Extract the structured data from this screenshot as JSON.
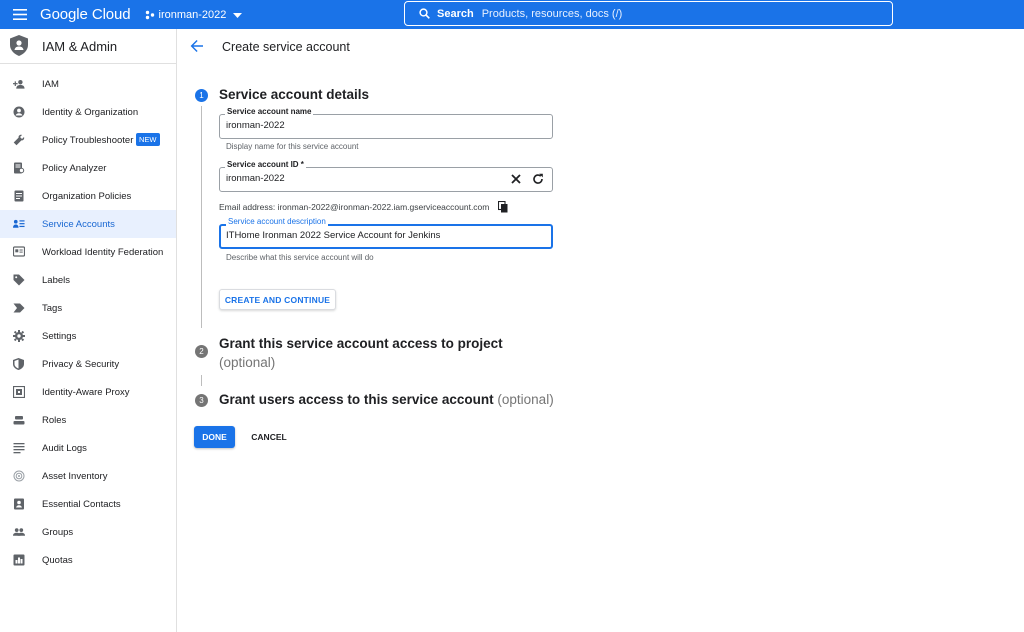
{
  "topbar": {
    "brand": "Google Cloud",
    "project": "ironman-2022",
    "search_label": "Search",
    "search_placeholder": "Products, resources, docs (/)",
    "accent": "#1a73e8"
  },
  "sidebar": {
    "title": "IAM & Admin",
    "items": [
      {
        "label": "IAM",
        "icon": "person-add-icon"
      },
      {
        "label": "Identity & Organization",
        "icon": "account-circle-icon"
      },
      {
        "label": "Policy Troubleshooter",
        "icon": "wrench-icon",
        "badge": "NEW"
      },
      {
        "label": "Policy Analyzer",
        "icon": "document-search-icon"
      },
      {
        "label": "Organization Policies",
        "icon": "document-icon"
      },
      {
        "label": "Service Accounts",
        "icon": "service-account-icon",
        "active": true
      },
      {
        "label": "Workload Identity Federation",
        "icon": "id-card-icon"
      },
      {
        "label": "Labels",
        "icon": "label-icon"
      },
      {
        "label": "Tags",
        "icon": "tag-arrow-icon"
      },
      {
        "label": "Settings",
        "icon": "gear-icon"
      },
      {
        "label": "Privacy & Security",
        "icon": "shield-icon"
      },
      {
        "label": "Identity-Aware Proxy",
        "icon": "proxy-icon"
      },
      {
        "label": "Roles",
        "icon": "roles-icon"
      },
      {
        "label": "Audit Logs",
        "icon": "list-icon"
      },
      {
        "label": "Asset Inventory",
        "icon": "inventory-icon"
      },
      {
        "label": "Essential Contacts",
        "icon": "contacts-icon"
      },
      {
        "label": "Groups",
        "icon": "groups-icon"
      },
      {
        "label": "Quotas",
        "icon": "quota-icon"
      }
    ]
  },
  "page": {
    "title": "Create service account"
  },
  "steps": [
    {
      "number": "1",
      "title": "Service account details"
    },
    {
      "number": "2",
      "title": "Grant this service account access to project",
      "optional": "(optional)"
    },
    {
      "number": "3",
      "title": "Grant users access to this service account",
      "optional": "(optional)"
    }
  ],
  "form": {
    "name": {
      "label": "Service account name",
      "value": "ironman-2022",
      "hint": "Display name for this service account"
    },
    "id": {
      "label": "Service account ID *",
      "value": "ironman-2022"
    },
    "email": "Email address: ironman-2022@ironman-2022.iam.gserviceaccount.com",
    "description": {
      "label": "Service account description",
      "value": "ITHome Ironman 2022 Service Account for Jenkins",
      "hint": "Describe what this service account will do"
    },
    "create_button": "CREATE AND CONTINUE"
  },
  "actions": {
    "done": "DONE",
    "cancel": "CANCEL"
  }
}
